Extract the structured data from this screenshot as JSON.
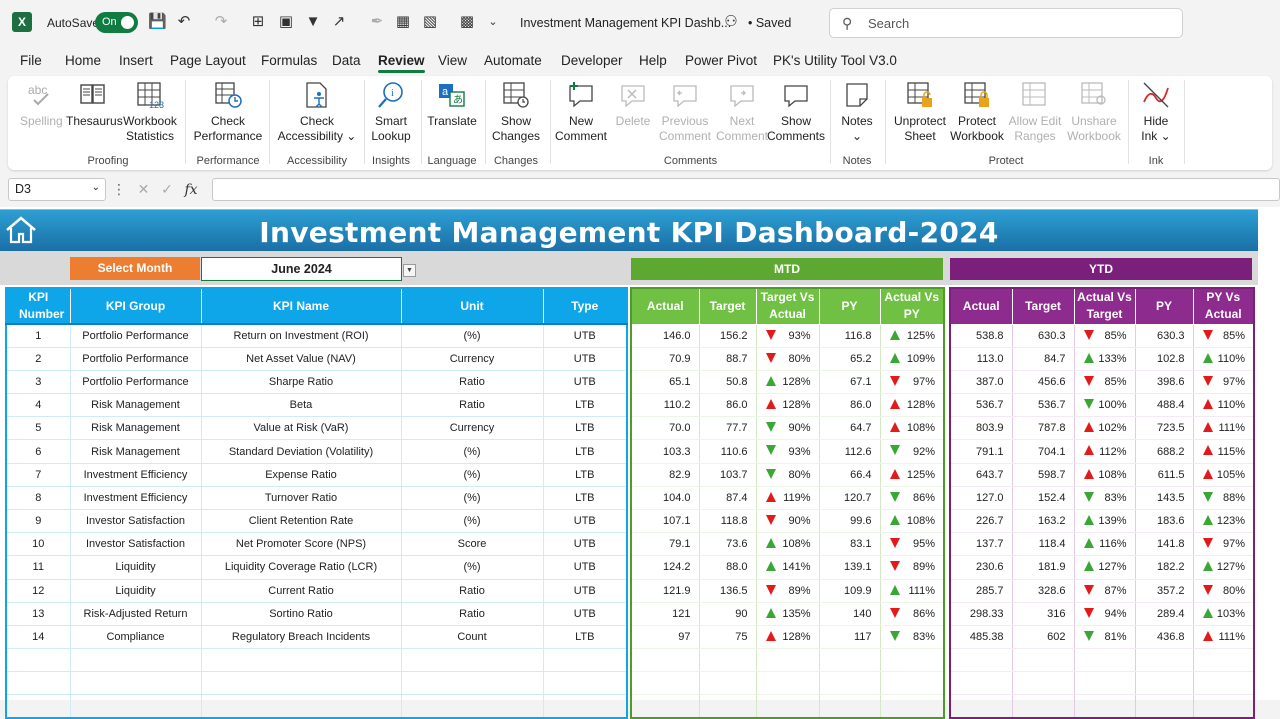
{
  "titlebar": {
    "autosave_label": "AutoSave",
    "autosave_state": "On",
    "doc_title": "Investment Management KPI Dashb...",
    "saved_label": "• Saved",
    "search_placeholder": "Search"
  },
  "menu_tabs": [
    "File",
    "Home",
    "Insert",
    "Page Layout",
    "Formulas",
    "Data",
    "Review",
    "View",
    "Automate",
    "Developer",
    "Help",
    "Power Pivot",
    "PK's Utility Tool V3.0"
  ],
  "active_tab": "Review",
  "ribbon": {
    "buttons": [
      {
        "label1": "Spelling",
        "label2": "",
        "disabled": true,
        "icon": "abc-spelling-icon"
      },
      {
        "label1": "Thesaurus",
        "label2": "",
        "disabled": false,
        "icon": "thesaurus-icon"
      },
      {
        "label1": "Workbook",
        "label2": "Statistics",
        "disabled": false,
        "icon": "workbook-statistics-icon"
      },
      {
        "label1": "Check",
        "label2": "Performance",
        "disabled": false,
        "icon": "check-performance-icon"
      },
      {
        "label1": "Check",
        "label2": "Accessibility ⌄",
        "disabled": false,
        "icon": "accessibility-icon"
      },
      {
        "label1": "Smart",
        "label2": "Lookup",
        "disabled": false,
        "icon": "smart-lookup-icon"
      },
      {
        "label1": "Translate",
        "label2": "",
        "disabled": false,
        "icon": "translate-icon"
      },
      {
        "label1": "Show",
        "label2": "Changes",
        "disabled": false,
        "icon": "show-changes-icon"
      },
      {
        "label1": "New",
        "label2": "Comment",
        "disabled": false,
        "icon": "new-comment-icon"
      },
      {
        "label1": "Delete",
        "label2": "",
        "disabled": true,
        "icon": "delete-comment-icon"
      },
      {
        "label1": "Previous",
        "label2": "Comment",
        "disabled": true,
        "icon": "previous-comment-icon"
      },
      {
        "label1": "Next",
        "label2": "Comment",
        "disabled": true,
        "icon": "next-comment-icon"
      },
      {
        "label1": "Show",
        "label2": "Comments",
        "disabled": false,
        "icon": "show-comments-icon"
      },
      {
        "label1": "Notes",
        "label2": "⌄",
        "disabled": false,
        "icon": "notes-icon"
      },
      {
        "label1": "Unprotect",
        "label2": "Sheet",
        "disabled": false,
        "icon": "unprotect-sheet-icon"
      },
      {
        "label1": "Protect",
        "label2": "Workbook",
        "disabled": false,
        "icon": "protect-workbook-icon"
      },
      {
        "label1": "Allow Edit",
        "label2": "Ranges",
        "disabled": true,
        "icon": "allow-edit-ranges-icon"
      },
      {
        "label1": "Unshare",
        "label2": "Workbook",
        "disabled": true,
        "icon": "unshare-workbook-icon"
      },
      {
        "label1": "Hide",
        "label2": "Ink ⌄",
        "disabled": false,
        "icon": "hide-ink-icon"
      }
    ],
    "groups": [
      "Proofing",
      "Performance",
      "Accessibility",
      "Insights",
      "Language",
      "Changes",
      "Comments",
      "Notes",
      "Protect",
      "Ink"
    ]
  },
  "formula_bar": {
    "name_box": "D3",
    "fx": "fx",
    "value": ""
  },
  "dashboard": {
    "title": "Investment Management KPI Dashboard-2024",
    "select_month_label": "Select Month",
    "selected_month": "June 2024",
    "mtd_label": "MTD",
    "ytd_label": "YTD",
    "kpi_headers": [
      "KPI Number",
      "KPI Group",
      "KPI Name",
      "Unit",
      "Type"
    ],
    "mtd_headers": [
      "Actual",
      "Target",
      "Target Vs Actual",
      "PY",
      "Actual Vs PY"
    ],
    "ytd_headers": [
      "Actual",
      "Target",
      "Actual Vs Target",
      "PY",
      "PY Vs Actual"
    ],
    "colors": {
      "banner": "#1a6fa6",
      "kpi_header": "#0ea5e9",
      "mtd": "#5da831",
      "ytd": "#7a1f7a",
      "select_month": "#ed7d31",
      "arrow_up": "#3aa635",
      "arrow_down": "#e21a1a"
    },
    "rows": [
      {
        "num": "1",
        "group": "Portfolio Performance",
        "name": "Return on Investment (ROI)",
        "unit": "(%)",
        "type": "UTB",
        "mtd": {
          "actual": "146.0",
          "target": "156.2",
          "tva": "93%",
          "tva_arrow": "down-red",
          "py": "116.8",
          "avp": "125%",
          "avp_arrow": "up-green"
        },
        "ytd": {
          "actual": "538.8",
          "target": "630.3",
          "avt": "85%",
          "avt_arrow": "down-red",
          "py": "630.3",
          "pva": "85%",
          "pva_arrow": "down-red"
        }
      },
      {
        "num": "2",
        "group": "Portfolio Performance",
        "name": "Net Asset Value (NAV)",
        "unit": "Currency",
        "type": "UTB",
        "mtd": {
          "actual": "70.9",
          "target": "88.7",
          "tva": "80%",
          "tva_arrow": "down-red",
          "py": "65.2",
          "avp": "109%",
          "avp_arrow": "up-green"
        },
        "ytd": {
          "actual": "113.0",
          "target": "84.7",
          "avt": "133%",
          "avt_arrow": "up-green",
          "py": "102.8",
          "pva": "110%",
          "pva_arrow": "up-green"
        }
      },
      {
        "num": "3",
        "group": "Portfolio Performance",
        "name": "Sharpe Ratio",
        "unit": "Ratio",
        "type": "UTB",
        "mtd": {
          "actual": "65.1",
          "target": "50.8",
          "tva": "128%",
          "tva_arrow": "up-green",
          "py": "67.1",
          "avp": "97%",
          "avp_arrow": "down-red"
        },
        "ytd": {
          "actual": "387.0",
          "target": "456.6",
          "avt": "85%",
          "avt_arrow": "down-red",
          "py": "398.6",
          "pva": "97%",
          "pva_arrow": "down-red"
        }
      },
      {
        "num": "4",
        "group": "Risk Management",
        "name": "Beta",
        "unit": "Ratio",
        "type": "LTB",
        "mtd": {
          "actual": "110.2",
          "target": "86.0",
          "tva": "128%",
          "tva_arrow": "up-red",
          "py": "86.0",
          "avp": "128%",
          "avp_arrow": "up-red"
        },
        "ytd": {
          "actual": "536.7",
          "target": "536.7",
          "avt": "100%",
          "avt_arrow": "down-green",
          "py": "488.4",
          "pva": "110%",
          "pva_arrow": "up-red"
        }
      },
      {
        "num": "5",
        "group": "Risk Management",
        "name": "Value at Risk (VaR)",
        "unit": "Currency",
        "type": "LTB",
        "mtd": {
          "actual": "70.0",
          "target": "77.7",
          "tva": "90%",
          "tva_arrow": "down-green",
          "py": "64.7",
          "avp": "108%",
          "avp_arrow": "up-red"
        },
        "ytd": {
          "actual": "803.9",
          "target": "787.8",
          "avt": "102%",
          "avt_arrow": "up-red",
          "py": "723.5",
          "pva": "111%",
          "pva_arrow": "up-red"
        }
      },
      {
        "num": "6",
        "group": "Risk Management",
        "name": "Standard Deviation (Volatility)",
        "unit": "(%)",
        "type": "LTB",
        "mtd": {
          "actual": "103.3",
          "target": "110.6",
          "tva": "93%",
          "tva_arrow": "down-green",
          "py": "112.6",
          "avp": "92%",
          "avp_arrow": "down-green"
        },
        "ytd": {
          "actual": "791.1",
          "target": "704.1",
          "avt": "112%",
          "avt_arrow": "up-red",
          "py": "688.2",
          "pva": "115%",
          "pva_arrow": "up-red"
        }
      },
      {
        "num": "7",
        "group": "Investment Efficiency",
        "name": "Expense Ratio",
        "unit": "(%)",
        "type": "LTB",
        "mtd": {
          "actual": "82.9",
          "target": "103.7",
          "tva": "80%",
          "tva_arrow": "down-green",
          "py": "66.4",
          "avp": "125%",
          "avp_arrow": "up-red"
        },
        "ytd": {
          "actual": "643.7",
          "target": "598.7",
          "avt": "108%",
          "avt_arrow": "up-red",
          "py": "611.5",
          "pva": "105%",
          "pva_arrow": "up-red"
        }
      },
      {
        "num": "8",
        "group": "Investment Efficiency",
        "name": "Turnover Ratio",
        "unit": "(%)",
        "type": "LTB",
        "mtd": {
          "actual": "104.0",
          "target": "87.4",
          "tva": "119%",
          "tva_arrow": "up-red",
          "py": "120.7",
          "avp": "86%",
          "avp_arrow": "down-green"
        },
        "ytd": {
          "actual": "127.0",
          "target": "152.4",
          "avt": "83%",
          "avt_arrow": "down-green",
          "py": "143.5",
          "pva": "88%",
          "pva_arrow": "down-green"
        }
      },
      {
        "num": "9",
        "group": "Investor Satisfaction",
        "name": "Client Retention Rate",
        "unit": "(%)",
        "type": "UTB",
        "mtd": {
          "actual": "107.1",
          "target": "118.8",
          "tva": "90%",
          "tva_arrow": "down-red",
          "py": "99.6",
          "avp": "108%",
          "avp_arrow": "up-green"
        },
        "ytd": {
          "actual": "226.7",
          "target": "163.2",
          "avt": "139%",
          "avt_arrow": "up-green",
          "py": "183.6",
          "pva": "123%",
          "pva_arrow": "up-green"
        }
      },
      {
        "num": "10",
        "group": "Investor Satisfaction",
        "name": "Net Promoter Score (NPS)",
        "unit": "Score",
        "type": "UTB",
        "mtd": {
          "actual": "79.1",
          "target": "73.6",
          "tva": "108%",
          "tva_arrow": "up-green",
          "py": "83.1",
          "avp": "95%",
          "avp_arrow": "down-red"
        },
        "ytd": {
          "actual": "137.7",
          "target": "118.4",
          "avt": "116%",
          "avt_arrow": "up-green",
          "py": "141.8",
          "pva": "97%",
          "pva_arrow": "down-red"
        }
      },
      {
        "num": "11",
        "group": "Liquidity",
        "name": "Liquidity Coverage Ratio (LCR)",
        "unit": "(%)",
        "type": "UTB",
        "mtd": {
          "actual": "124.2",
          "target": "88.0",
          "tva": "141%",
          "tva_arrow": "up-green",
          "py": "139.1",
          "avp": "89%",
          "avp_arrow": "down-red"
        },
        "ytd": {
          "actual": "230.6",
          "target": "181.9",
          "avt": "127%",
          "avt_arrow": "up-green",
          "py": "182.2",
          "pva": "127%",
          "pva_arrow": "up-green"
        }
      },
      {
        "num": "12",
        "group": "Liquidity",
        "name": "Current Ratio",
        "unit": "Ratio",
        "type": "UTB",
        "mtd": {
          "actual": "121.9",
          "target": "136.5",
          "tva": "89%",
          "tva_arrow": "down-red",
          "py": "109.9",
          "avp": "111%",
          "avp_arrow": "up-green"
        },
        "ytd": {
          "actual": "285.7",
          "target": "328.6",
          "avt": "87%",
          "avt_arrow": "down-red",
          "py": "357.2",
          "pva": "80%",
          "pva_arrow": "down-red"
        }
      },
      {
        "num": "13",
        "group": "Risk-Adjusted Return",
        "name": "Sortino Ratio",
        "unit": "Ratio",
        "type": "UTB",
        "mtd": {
          "actual": "121",
          "target": "90",
          "tva": "135%",
          "tva_arrow": "up-green",
          "py": "140",
          "avp": "86%",
          "avp_arrow": "down-red"
        },
        "ytd": {
          "actual": "298.33",
          "target": "316",
          "avt": "94%",
          "avt_arrow": "down-red",
          "py": "289.4",
          "pva": "103%",
          "pva_arrow": "up-green"
        }
      },
      {
        "num": "14",
        "group": "Compliance",
        "name": "Regulatory Breach Incidents",
        "unit": "Count",
        "type": "LTB",
        "mtd": {
          "actual": "97",
          "target": "75",
          "tva": "128%",
          "tva_arrow": "up-red",
          "py": "117",
          "avp": "83%",
          "avp_arrow": "down-green"
        },
        "ytd": {
          "actual": "485.38",
          "target": "602",
          "avt": "81%",
          "avt_arrow": "down-green",
          "py": "436.8",
          "pva": "111%",
          "pva_arrow": "up-red"
        }
      }
    ]
  }
}
